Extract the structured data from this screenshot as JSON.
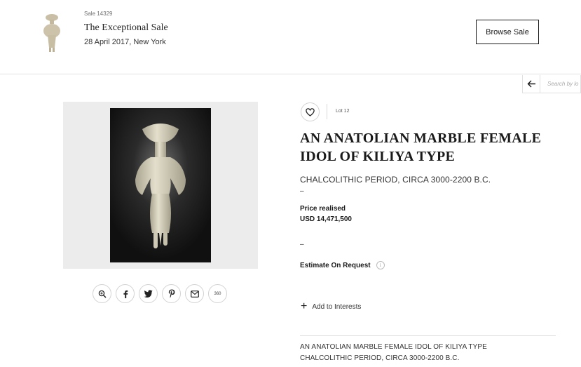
{
  "header": {
    "sale_number": "Sale 14329",
    "sale_title": "The Exceptional Sale",
    "sale_date": "28 April 2017, New York",
    "browse_label": "Browse Sale",
    "thumbnail_icon": "idol-thumbnail"
  },
  "search": {
    "placeholder": "Search by lo",
    "back_icon": "arrow-left-icon"
  },
  "lot": {
    "lot_number": "Lot 12",
    "title": "AN ANATOLIAN MARBLE FEMALE IDOL OF KILIYA TYPE",
    "subtitle": "CHALCOLITHIC PERIOD, CIRCA 3000-2200 B.C.",
    "dash_1": "–",
    "price_label": "Price realised",
    "price_value": "USD 14,471,500",
    "dash_2": "–",
    "estimate_label": "Estimate On Request",
    "info_glyph": "i",
    "interests_label": "Add to Interests",
    "plus_glyph": "+",
    "description_line_1": "AN ANATOLIAN MARBLE FEMALE IDOL OF KILIYA TYPE",
    "description_line_2": "CHALCOLITHIC PERIOD, CIRCA 3000-2200 B.C."
  },
  "share": {
    "icons": [
      "zoom-icon",
      "facebook-icon",
      "twitter-icon",
      "pinterest-icon",
      "email-icon",
      "360-view-icon"
    ],
    "label_360": "360"
  },
  "colors": {
    "text": "#1a1a1a",
    "panel_bg": "#ececec",
    "border": "#d2d2d2"
  }
}
